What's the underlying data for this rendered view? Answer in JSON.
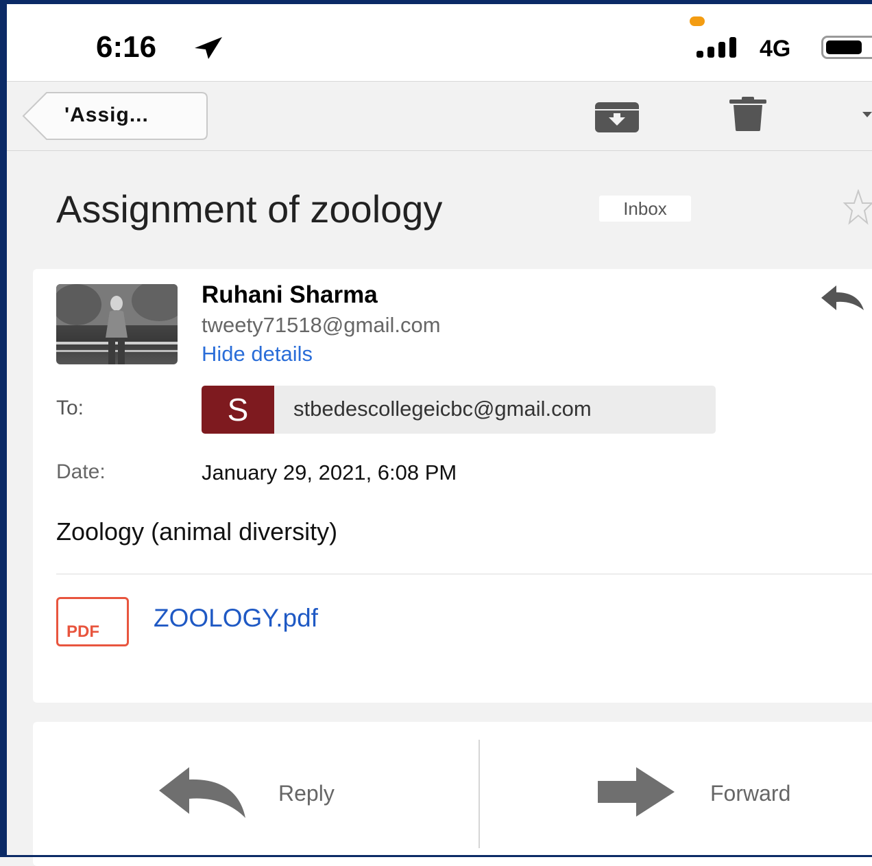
{
  "status_bar": {
    "time": "6:16",
    "network": "4G",
    "icons": [
      "location-arrow-icon",
      "signal-bars-icon",
      "battery-icon"
    ],
    "indicator_color": "#f39c12"
  },
  "nav": {
    "back_label": "'Assig...",
    "icons": [
      "archive-icon",
      "trash-icon",
      "chevron-down-icon"
    ]
  },
  "email": {
    "subject": "Assignment of zoology",
    "label": "Inbox",
    "sender": {
      "name": "Ruhani Sharma",
      "email": "tweety71518@gmail.com",
      "details_toggle": "Hide details"
    },
    "to": {
      "label": "To:",
      "initial": "S",
      "address": "stbedescollegeicbc@gmail.com",
      "avatar_color": "#7e1a1f"
    },
    "date": {
      "label": "Date:",
      "value": "January 29, 2021, 6:08 PM"
    },
    "body": "Zoology (animal diversity)",
    "attachment": {
      "type_label": "PDF",
      "filename": "ZOOLOGY.pdf",
      "link_color": "#1f59c4"
    }
  },
  "actions": {
    "reply_label": "Reply",
    "forward_label": "Forward"
  }
}
